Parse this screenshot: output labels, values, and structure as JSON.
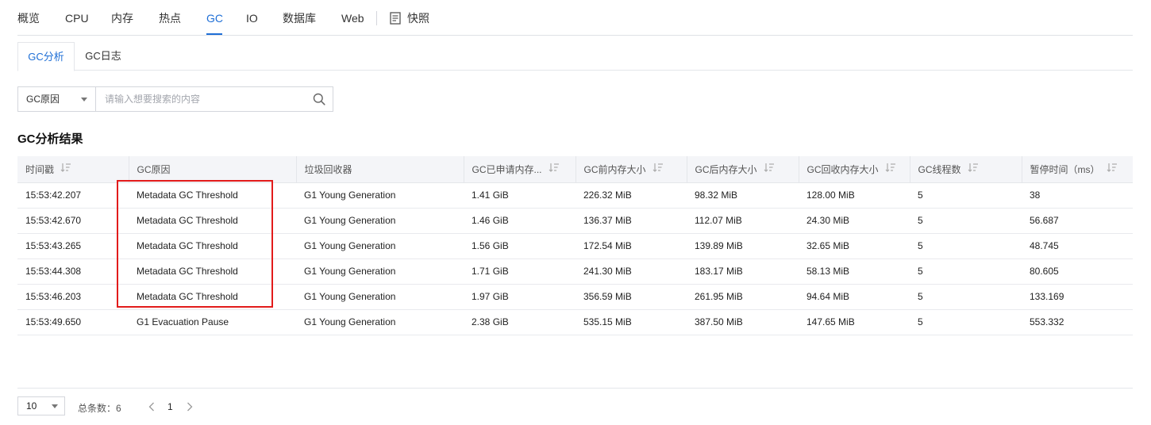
{
  "top_nav": {
    "tabs": [
      "概览",
      "CPU",
      "内存",
      "热点",
      "GC",
      "IO",
      "数据库",
      "Web"
    ],
    "active": "GC",
    "snapshot_label": "快照",
    "snapshot_icon": "snapshot-icon"
  },
  "sub_tabs": {
    "tabs": [
      "GC分析",
      "GC日志"
    ],
    "active": "GC分析"
  },
  "search": {
    "field_select": "GC原因",
    "placeholder": "请输入想要搜索的内容",
    "icon": "search-icon"
  },
  "section_title": "GC分析结果",
  "table": {
    "headers": [
      "时间戳",
      "GC原因",
      "垃圾回收器",
      "GC已申请内存...",
      "GC前内存大小",
      "GC后内存大小",
      "GC回收内存大小",
      "GC线程数",
      "暂停时间（ms）"
    ],
    "rows": [
      [
        "15:53:42.207",
        "Metadata GC Threshold",
        "G1 Young Generation",
        "1.41 GiB",
        "226.32 MiB",
        "98.32 MiB",
        "128.00 MiB",
        "5",
        "38"
      ],
      [
        "15:53:42.670",
        "Metadata GC Threshold",
        "G1 Young Generation",
        "1.46 GiB",
        "136.37 MiB",
        "112.07 MiB",
        "24.30 MiB",
        "5",
        "56.687"
      ],
      [
        "15:53:43.265",
        "Metadata GC Threshold",
        "G1 Young Generation",
        "1.56 GiB",
        "172.54 MiB",
        "139.89 MiB",
        "32.65 MiB",
        "5",
        "48.745"
      ],
      [
        "15:53:44.308",
        "Metadata GC Threshold",
        "G1 Young Generation",
        "1.71 GiB",
        "241.30 MiB",
        "183.17 MiB",
        "58.13 MiB",
        "5",
        "80.605"
      ],
      [
        "15:53:46.203",
        "Metadata GC Threshold",
        "G1 Young Generation",
        "1.97 GiB",
        "356.59 MiB",
        "261.95 MiB",
        "94.64 MiB",
        "5",
        "133.169"
      ],
      [
        "15:53:49.650",
        "G1 Evacuation Pause",
        "G1 Young Generation",
        "2.38 GiB",
        "535.15 MiB",
        "387.50 MiB",
        "147.65 MiB",
        "5",
        "553.332"
      ]
    ]
  },
  "pagination": {
    "page_size": "10",
    "total_label": "总条数：6",
    "current_page": "1"
  },
  "colors": {
    "accent": "#1f6fd6",
    "highlight": "#e21b1b"
  }
}
